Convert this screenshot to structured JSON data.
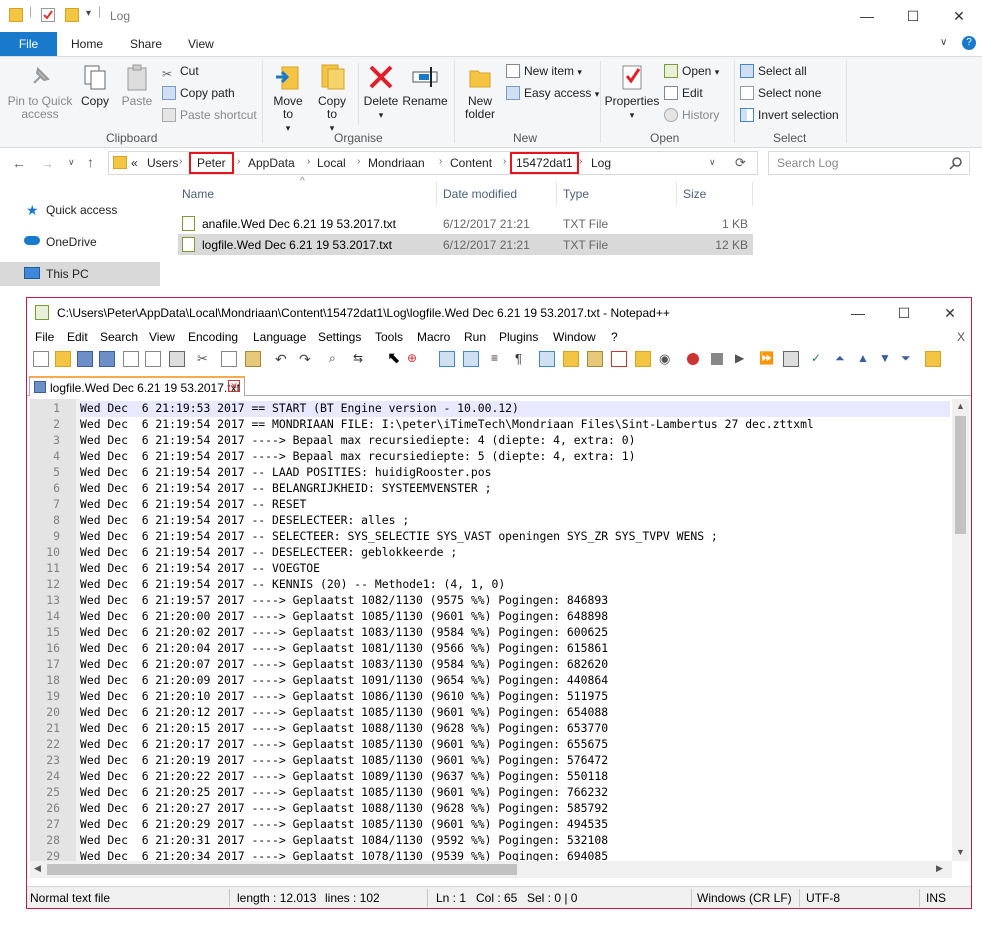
{
  "explorer": {
    "title": "Log",
    "tabs": [
      "File",
      "Home",
      "Share",
      "View"
    ],
    "ribbon": {
      "clipboard": {
        "label": "Clipboard",
        "pin": "Pin to Quick access",
        "copy": "Copy",
        "paste": "Paste",
        "cut": "Cut",
        "copy_path": "Copy path",
        "paste_shortcut": "Paste shortcut"
      },
      "organise": {
        "label": "Organise",
        "move_to": "Move to",
        "copy_to": "Copy to",
        "delete": "Delete",
        "rename": "Rename"
      },
      "new": {
        "label": "New",
        "new_folder": "New folder",
        "new_item": "New item",
        "easy_access": "Easy access"
      },
      "open": {
        "label": "Open",
        "properties": "Properties",
        "open": "Open",
        "edit": "Edit",
        "history": "History"
      },
      "select": {
        "label": "Select",
        "select_all": "Select all",
        "select_none": "Select none",
        "invert": "Invert selection"
      }
    },
    "address": {
      "prefix": "«",
      "crumbs": [
        "Users",
        "Peter",
        "AppData",
        "Local",
        "Mondriaan",
        "Content",
        "15472dat1",
        "Log"
      ]
    },
    "search_placeholder": "Search Log",
    "nav": [
      "Quick access",
      "OneDrive",
      "This PC"
    ],
    "columns": [
      "Name",
      "Date modified",
      "Type",
      "Size"
    ],
    "files": [
      {
        "name": "anafile.Wed Dec  6.21 19 53.2017.txt",
        "date": "6/12/2017 21:21",
        "type": "TXT File",
        "size": "1 KB"
      },
      {
        "name": "logfile.Wed Dec  6.21 19 53.2017.txt",
        "date": "6/12/2017 21:21",
        "type": "TXT File",
        "size": "12 KB"
      }
    ]
  },
  "npp": {
    "title": "C:\\Users\\Peter\\AppData\\Local\\Mondriaan\\Content\\15472dat1\\Log\\logfile.Wed Dec  6.21 19 53.2017.txt - Notepad++",
    "menu": [
      "File",
      "Edit",
      "Search",
      "View",
      "Encoding",
      "Language",
      "Settings",
      "Tools",
      "Macro",
      "Run",
      "Plugins",
      "Window",
      "?"
    ],
    "menu_close": "X",
    "tab": "logfile.Wed Dec  6.21 19 53.2017.txt",
    "lines": [
      "Wed Dec  6 21:19:53 2017 == START (BT Engine version - 10.00.12)",
      "Wed Dec  6 21:19:54 2017 == MONDRIAAN FILE: I:\\peter\\iTimeTech\\Mondriaan Files\\Sint-Lambertus 27 dec.zttxml",
      "Wed Dec  6 21:19:54 2017 ----> Bepaal max recursiediepte: 4 (diepte: 4, extra: 0)",
      "Wed Dec  6 21:19:54 2017 ----> Bepaal max recursiediepte: 5 (diepte: 4, extra: 1)",
      "Wed Dec  6 21:19:54 2017 -- LAAD POSITIES: huidigRooster.pos",
      "Wed Dec  6 21:19:54 2017 -- BELANGRIJKHEID: SYSTEEMVENSTER ;",
      "Wed Dec  6 21:19:54 2017 -- RESET",
      "Wed Dec  6 21:19:54 2017 -- DESELECTEER: alles ;",
      "Wed Dec  6 21:19:54 2017 -- SELECTEER: SYS_SELECTIE SYS_VAST openingen SYS_ZR SYS_TVPV WENS ;",
      "Wed Dec  6 21:19:54 2017 -- DESELECTEER: geblokkeerde ;",
      "Wed Dec  6 21:19:54 2017 -- VOEGTOE",
      "Wed Dec  6 21:19:54 2017 -- KENNIS (20) -- Methode1: (4, 1, 0)",
      "Wed Dec  6 21:19:57 2017 ----> Geplaatst 1082/1130 (9575 %%) Pogingen: 846893",
      "Wed Dec  6 21:20:00 2017 ----> Geplaatst 1085/1130 (9601 %%) Pogingen: 648898",
      "Wed Dec  6 21:20:02 2017 ----> Geplaatst 1083/1130 (9584 %%) Pogingen: 600625",
      "Wed Dec  6 21:20:04 2017 ----> Geplaatst 1081/1130 (9566 %%) Pogingen: 615861",
      "Wed Dec  6 21:20:07 2017 ----> Geplaatst 1083/1130 (9584 %%) Pogingen: 682620",
      "Wed Dec  6 21:20:09 2017 ----> Geplaatst 1091/1130 (9654 %%) Pogingen: 440864",
      "Wed Dec  6 21:20:10 2017 ----> Geplaatst 1086/1130 (9610 %%) Pogingen: 511975",
      "Wed Dec  6 21:20:12 2017 ----> Geplaatst 1085/1130 (9601 %%) Pogingen: 654088",
      "Wed Dec  6 21:20:15 2017 ----> Geplaatst 1088/1130 (9628 %%) Pogingen: 653770",
      "Wed Dec  6 21:20:17 2017 ----> Geplaatst 1085/1130 (9601 %%) Pogingen: 655675",
      "Wed Dec  6 21:20:19 2017 ----> Geplaatst 1085/1130 (9601 %%) Pogingen: 576472",
      "Wed Dec  6 21:20:22 2017 ----> Geplaatst 1089/1130 (9637 %%) Pogingen: 550118",
      "Wed Dec  6 21:20:25 2017 ----> Geplaatst 1085/1130 (9601 %%) Pogingen: 766232",
      "Wed Dec  6 21:20:27 2017 ----> Geplaatst 1088/1130 (9628 %%) Pogingen: 585792",
      "Wed Dec  6 21:20:29 2017 ----> Geplaatst 1085/1130 (9601 %%) Pogingen: 494535",
      "Wed Dec  6 21:20:31 2017 ----> Geplaatst 1084/1130 (9592 %%) Pogingen: 532108",
      "Wed Dec  6 21:20:34 2017 ----> Geplaatst 1078/1130 (9539 %%) Pogingen: 694085"
    ],
    "status": {
      "type": "Normal text file",
      "length": "length : 12.013",
      "lines": "lines : 102",
      "ln": "Ln : 1",
      "col": "Col : 65",
      "sel": "Sel : 0 | 0",
      "eol": "Windows (CR LF)",
      "enc": "UTF-8",
      "ins": "INS"
    }
  }
}
